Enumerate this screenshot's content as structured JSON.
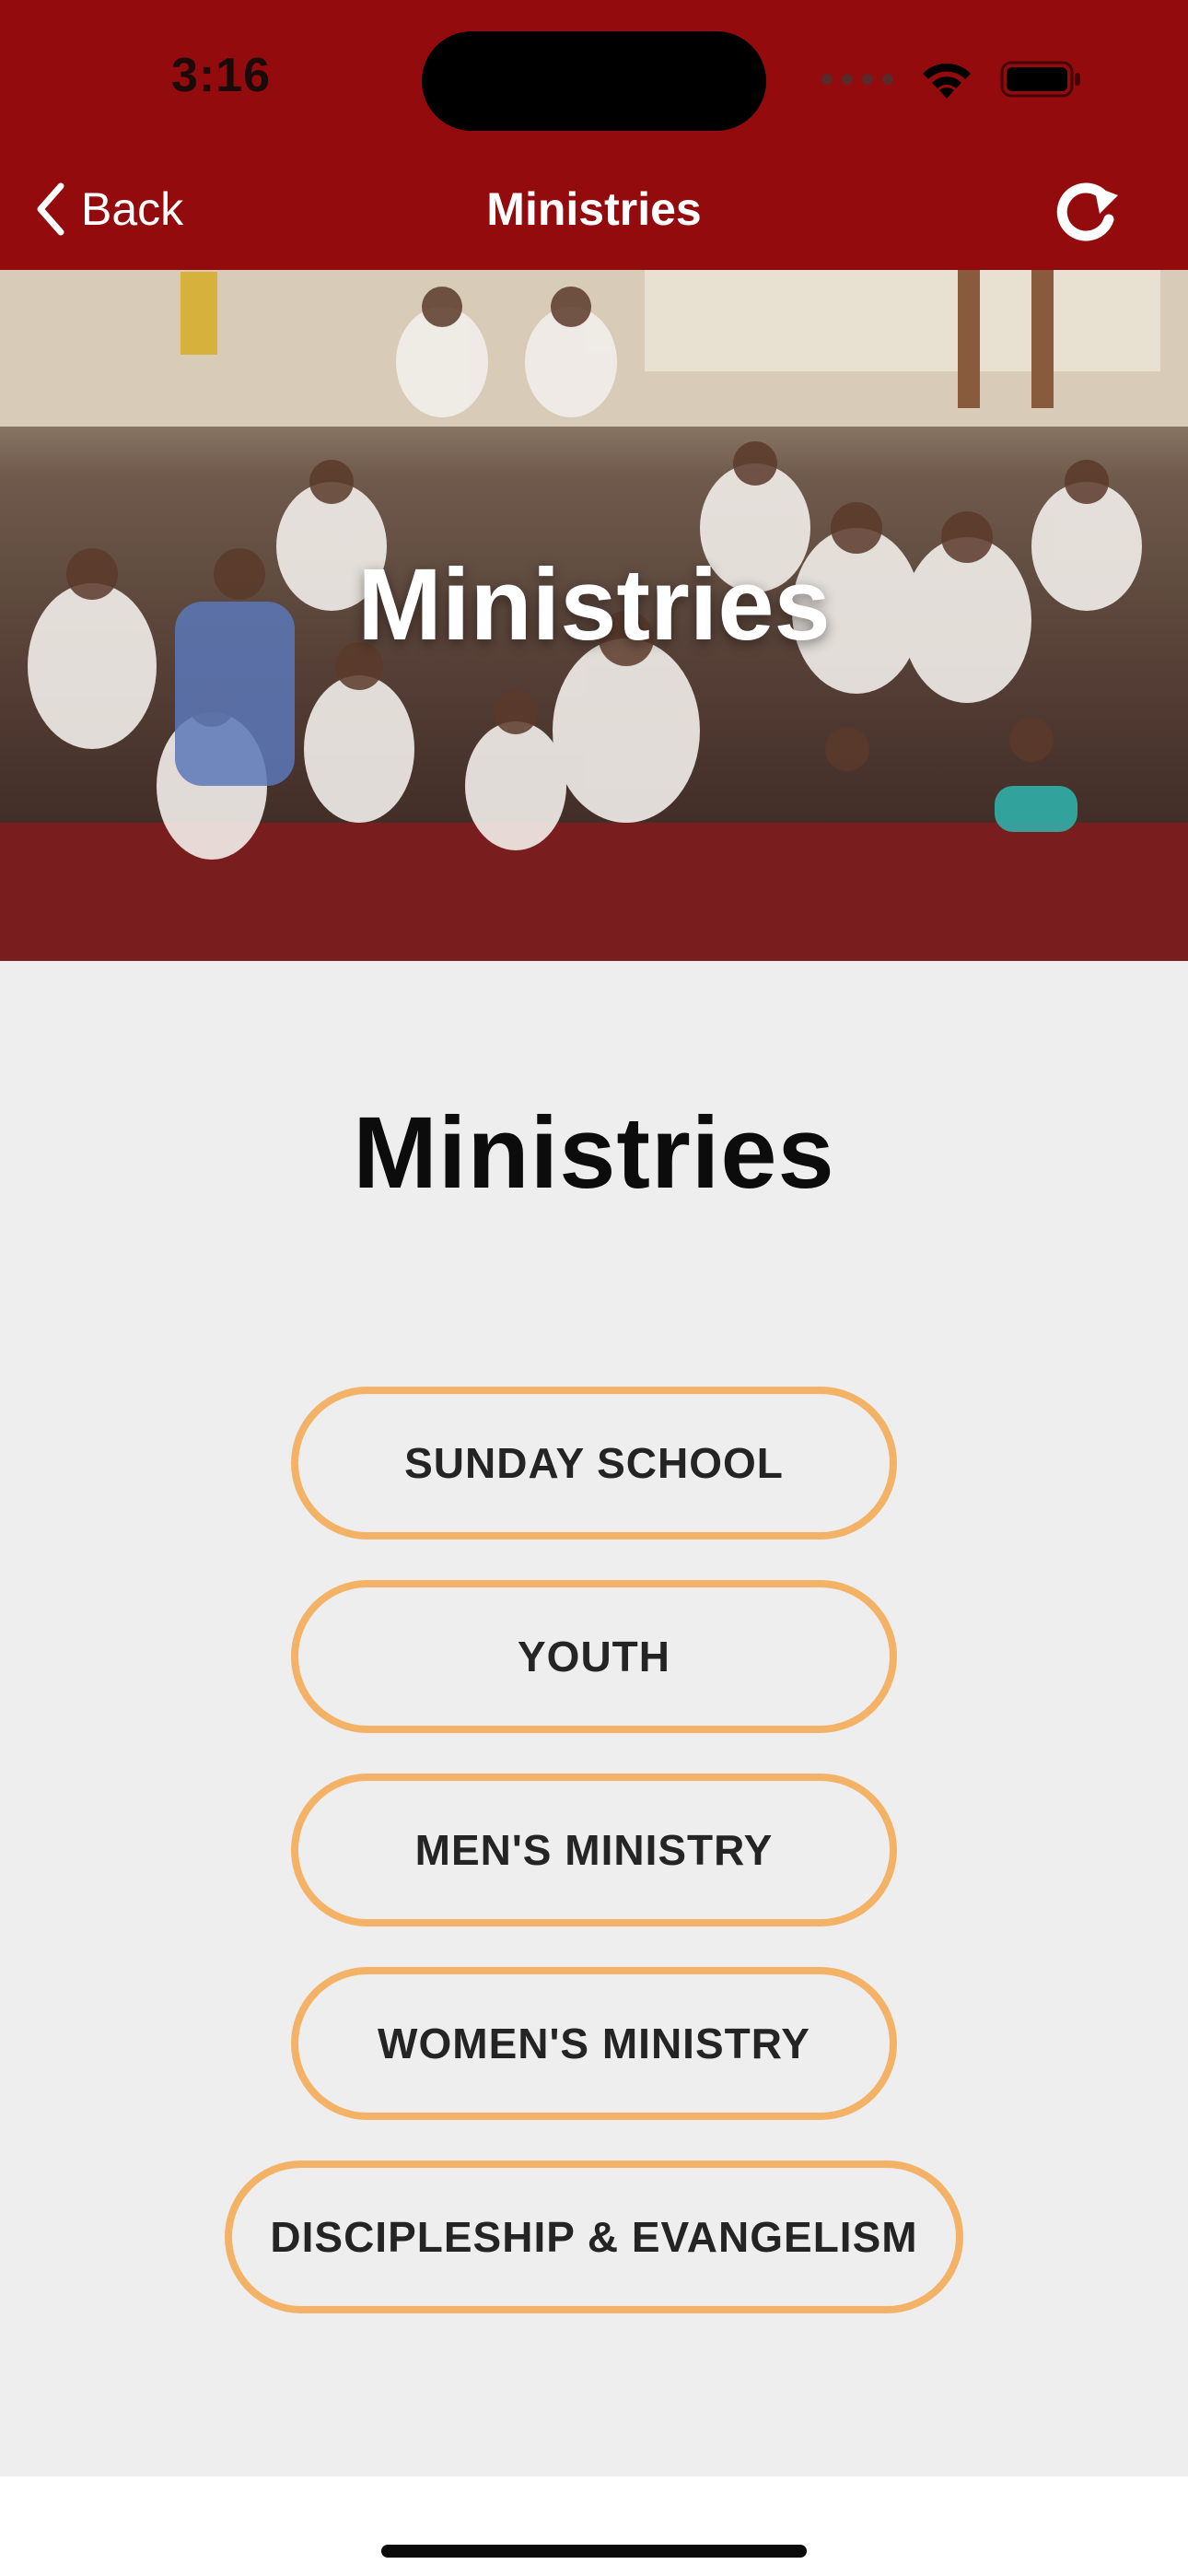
{
  "status_bar": {
    "time": "3:16"
  },
  "nav": {
    "back_label": "Back",
    "title": "Ministries"
  },
  "hero": {
    "title": "Ministries"
  },
  "main": {
    "title": "Ministries",
    "buttons": [
      "SUNDAY SCHOOL",
      "YOUTH",
      "MEN'S MINISTRY",
      "WOMEN'S MINISTRY",
      "DISCIPLESHIP & EVANGELISM"
    ]
  },
  "colors": {
    "header_bg": "#940b0d",
    "accent_border": "#f3b266",
    "content_bg": "#eeeeee"
  },
  "icons": {
    "back": "chevron-left-icon",
    "refresh": "refresh-icon",
    "wifi": "wifi-icon",
    "battery": "battery-icon",
    "signal": "cellular-signal-icon"
  }
}
